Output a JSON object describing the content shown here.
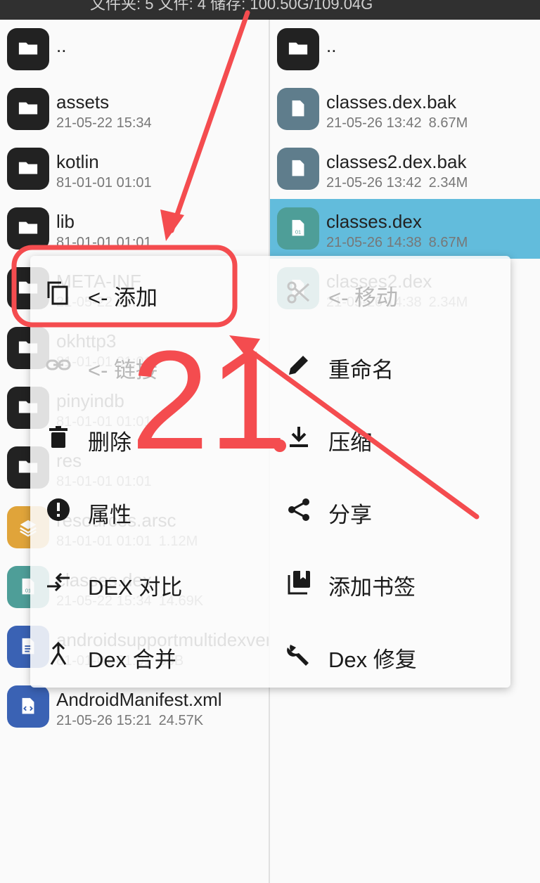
{
  "status_bar": {
    "text": "文件夹: 5  文件: 4  储存: 100.50G/109.04G"
  },
  "left_panel": {
    "items": [
      {
        "name": "..",
        "meta": "",
        "size": "",
        "icon": "folder-icon",
        "color": "#222222"
      },
      {
        "name": "assets",
        "meta": "21-05-22 15:34",
        "size": "",
        "icon": "folder-icon",
        "color": "#222222"
      },
      {
        "name": "kotlin",
        "meta": "81-01-01 01:01",
        "size": "",
        "icon": "folder-icon",
        "color": "#222222"
      },
      {
        "name": "lib",
        "meta": "81-01-01 01:01",
        "size": "",
        "icon": "folder-icon",
        "color": "#222222"
      },
      {
        "name": "META-INF",
        "meta": "21-05-22 15:38",
        "size": "",
        "icon": "folder-icon",
        "color": "#222222"
      },
      {
        "name": "okhttp3",
        "meta": "81-01-01 01:01",
        "size": "",
        "icon": "folder-icon",
        "color": "#222222"
      },
      {
        "name": "pinyindb",
        "meta": "81-01-01 01:01",
        "size": "",
        "icon": "folder-icon",
        "color": "#222222"
      },
      {
        "name": "res",
        "meta": "81-01-01 01:01",
        "size": "",
        "icon": "folder-icon",
        "color": "#222222"
      },
      {
        "name": "resources.arsc",
        "meta": "81-01-01 01:01",
        "size": "1.12M",
        "icon": "layers-icon",
        "color": "#e0a43a"
      },
      {
        "name": "classes.dex",
        "meta": "21-05-22 15:34",
        "size": "14.69K",
        "icon": "dex-file-icon",
        "color": "#4e9e98"
      },
      {
        "name": "androidsupportmultidexversion.txt",
        "meta": "81-01-01 01:01",
        "size": "53B",
        "icon": "text-file-icon",
        "color": "#3a62b4"
      },
      {
        "name": "AndroidManifest.xml",
        "meta": "21-05-26 15:21",
        "size": "24.57K",
        "icon": "xml-file-icon",
        "color": "#3a62b4"
      }
    ]
  },
  "right_panel": {
    "items": [
      {
        "name": "..",
        "meta": "",
        "size": "",
        "icon": "folder-icon",
        "color": "#222222"
      },
      {
        "name": "classes.dex.bak",
        "meta": "21-05-26 13:42",
        "size": "8.67M",
        "icon": "file-icon",
        "color": "#5f7d8c"
      },
      {
        "name": "classes2.dex.bak",
        "meta": "21-05-26 13:42",
        "size": "2.34M",
        "icon": "file-icon",
        "color": "#5f7d8c"
      },
      {
        "name": "classes.dex",
        "meta": "21-05-26 14:38",
        "size": "8.67M",
        "icon": "dex-file-icon",
        "color": "#4e9e98"
      },
      {
        "name": "classes2.dex",
        "meta": "21-05-26 14:38",
        "size": "2.34M",
        "icon": "dex-file-icon",
        "color": "#4e9e98"
      }
    ],
    "selected_index": 3
  },
  "context_menu": {
    "left_column": [
      {
        "label": "<- 添加",
        "icon": "copy-icon",
        "enabled": true
      },
      {
        "label": "<- 链接",
        "icon": "link-icon",
        "enabled": false
      },
      {
        "label": "删除",
        "icon": "delete-icon",
        "enabled": true
      },
      {
        "label": "属性",
        "icon": "info-icon",
        "enabled": true
      },
      {
        "label": "DEX 对比",
        "icon": "compare-arrows-icon",
        "enabled": true
      },
      {
        "label": "Dex 合并",
        "icon": "merge-icon",
        "enabled": true
      }
    ],
    "right_column": [
      {
        "label": "<- 移动",
        "icon": "cut-icon",
        "enabled": false
      },
      {
        "label": "重命名",
        "icon": "edit-icon",
        "enabled": true
      },
      {
        "label": "压缩",
        "icon": "download-icon",
        "enabled": true
      },
      {
        "label": "分享",
        "icon": "share-icon",
        "enabled": true
      },
      {
        "label": "添加书签",
        "icon": "bookmarks-icon",
        "enabled": true
      },
      {
        "label": "Dex 修复",
        "icon": "wrench-icon",
        "enabled": true
      }
    ]
  },
  "annotation": {
    "number": "21",
    "color": "#f44c4f"
  }
}
